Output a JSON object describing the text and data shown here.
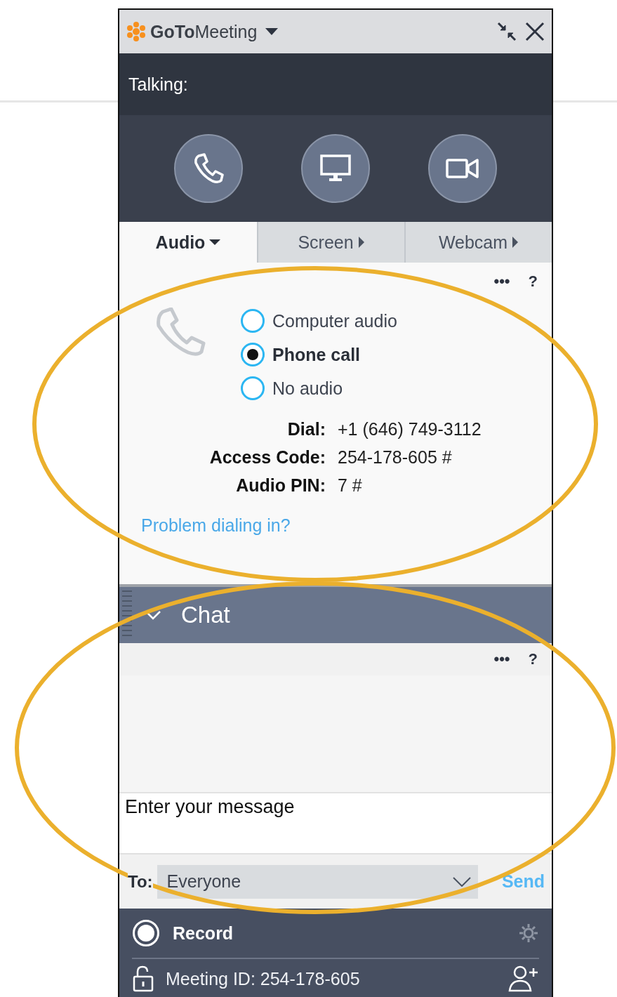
{
  "window": {
    "title": "**GoTo**Meeting"
  },
  "talking": {
    "label": "Talking:"
  },
  "call_buttons": [
    {
      "kind": "phone"
    },
    {
      "kind": "screen"
    },
    {
      "kind": "webcam"
    }
  ],
  "tabs": [
    {
      "label": "Audio",
      "selected": true,
      "expanded": true
    },
    {
      "label": "Screen",
      "selected": false,
      "expanded": false
    },
    {
      "label": "Webcam",
      "selected": false,
      "expanded": false
    }
  ],
  "audio": {
    "menu": "•••",
    "help": "?",
    "options": [
      {
        "label": "Computer audio",
        "selected": false
      },
      {
        "label": "Phone call",
        "selected": true
      },
      {
        "label": "No audio",
        "selected": false
      }
    ],
    "details": [
      {
        "label": "Dial:",
        "value": "+1 (646) 749-3112"
      },
      {
        "label": "Access Code:",
        "value": "254-178-605 #"
      },
      {
        "label": "Audio PIN:",
        "value": "7 #"
      }
    ],
    "link": "Problem dialing in?"
  },
  "chat": {
    "title": "Chat",
    "expanded": true,
    "menu": "•••",
    "help": "?",
    "message": {
      "placeholder": "Enter your message"
    },
    "to_label": "To:",
    "recipient": "Everyone",
    "send": "Send"
  },
  "footer": {
    "record": "Record",
    "meeting_id": "Meeting ID: 254-178-605"
  },
  "annotations": [
    {
      "kind": "ellipse"
    },
    {
      "kind": "ellipse"
    }
  ]
}
